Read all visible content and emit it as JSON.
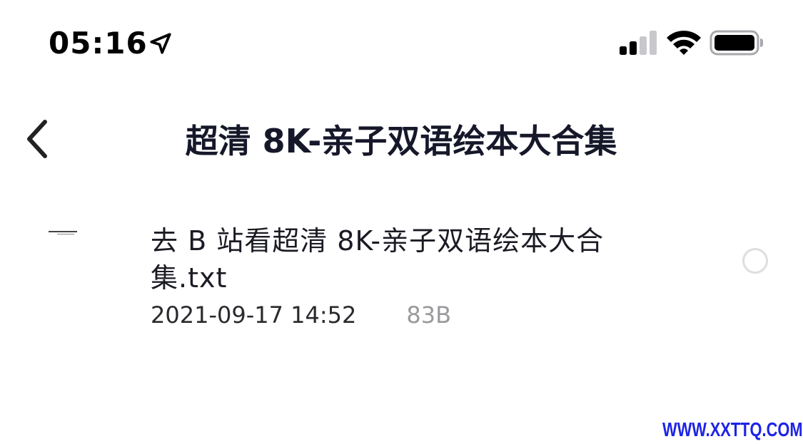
{
  "status_bar": {
    "time": "05:16",
    "icons": [
      "location-arrow-icon",
      "cellular-signal-icon",
      "wifi-icon",
      "battery-icon"
    ],
    "signal_bars_active": 2,
    "signal_bars_total": 4
  },
  "nav": {
    "back_icon": "chevron-left-icon",
    "title": "超清 8K-亲子双语绘本大合集"
  },
  "files": [
    {
      "name": "去 B 站看超清 8K-亲子双语绘本大合集.txt",
      "date": "2021-09-17 14:52",
      "size": "83B",
      "selected": false
    }
  ],
  "watermark": {
    "text": "WWW.XXTTQ.COM",
    "color": "#1d24e6"
  },
  "colors": {
    "title": "#16182a",
    "meta_secondary": "#9a9a9e",
    "radio_border": "#dedede"
  }
}
